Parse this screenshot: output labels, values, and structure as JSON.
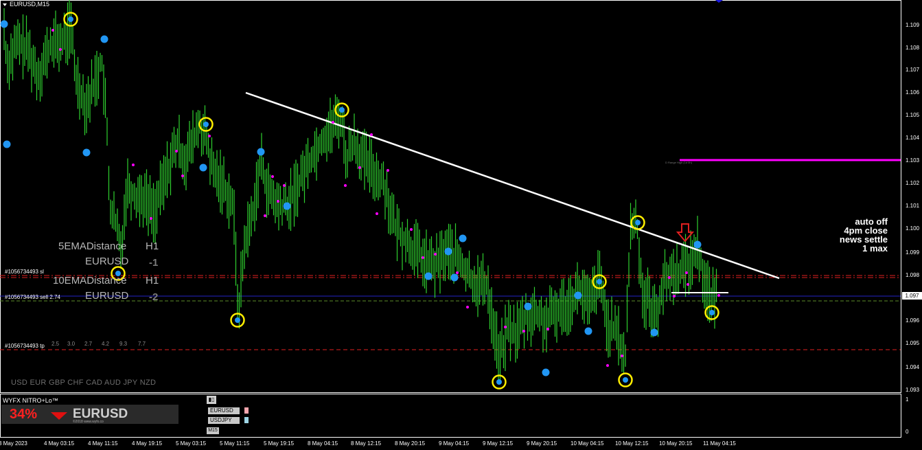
{
  "window": {
    "symbol_timeframe": "EURUSD,M15"
  },
  "price_axis": {
    "labels": [
      "1.109",
      "1.108",
      "1.107",
      "1.106",
      "1.105",
      "1.104",
      "1.103",
      "1.102",
      "1.101",
      "1.100",
      "1.099",
      "1.098",
      "1.096",
      "1.095",
      "1.094",
      "1.093"
    ],
    "current_price": "1.097",
    "current_price_value": 1.0971
  },
  "time_axis": {
    "labels": [
      "3 May 2023",
      "4 May 03:15",
      "4 May 11:15",
      "4 May 19:15",
      "5 May 03:15",
      "5 May 11:15",
      "5 May 19:15",
      "8 May 04:15",
      "8 May 12:15",
      "8 May 20:15",
      "9 May 04:15",
      "9 May 12:15",
      "9 May 20:15",
      "10 May 04:15",
      "10 May 12:15",
      "10 May 20:15",
      "11 May 04:15"
    ]
  },
  "indicators": {
    "ema5": {
      "name": "5EMADistance",
      "tf": "H1",
      "symbol": "EURUSD",
      "value": "-1"
    },
    "ema10": {
      "name": "10EMADistance",
      "tf": "H1",
      "symbol": "EURUSD",
      "value": "-2"
    }
  },
  "trades": {
    "sl_label": "#1056734493 sl",
    "sell_label": "#1056734493 sell 2.74",
    "tp_label": "#1056734493 tp",
    "tp_levels": [
      "2.5",
      "3.0",
      "2.7",
      "4.2",
      "9.3",
      "7.7"
    ]
  },
  "currency_strip": "USD EUR GBP CHF CAD AUD JPY NZD",
  "note": {
    "lines": [
      "auto off",
      "4pm close",
      "news settle",
      "1 max"
    ]
  },
  "subwindow": {
    "title": "WYFX NITRO+Lo™",
    "percent": "34%",
    "symbol": "EURUSD",
    "copyright": "©2018 www.wyfx.co",
    "pairs": [
      "EURUSD",
      "USDJPY"
    ],
    "pair_colors": [
      "#f4a6ae",
      "#9fd6e6"
    ],
    "timeframe": "M15",
    "scale": [
      "1",
      "0"
    ]
  },
  "colors": {
    "candles": "#2fd12f",
    "swing_dot": "#2196f3",
    "small_dot": "#ff00ff",
    "ring": "#ffee00",
    "trendline": "#ffffff",
    "resistance": "#ff00ff",
    "sl_line": "#e02020",
    "entry_line": "#2323c8",
    "down_arrow": "#e02020"
  },
  "chart_data": {
    "type": "line",
    "title": "EURUSD,M15",
    "ylim": [
      1.0928,
      1.11
    ],
    "x": [
      "3 May 2023",
      "4 May 03:15",
      "4 May 11:15",
      "4 May 19:15",
      "5 May 03:15",
      "5 May 11:15",
      "5 May 19:15",
      "8 May 04:15",
      "8 May 12:15",
      "8 May 20:15",
      "9 May 04:15",
      "9 May 12:15",
      "9 May 20:15",
      "10 May 04:15",
      "10 May 12:15",
      "10 May 20:15",
      "11 May 04:15"
    ],
    "series": [
      {
        "name": "",
        "values": [
          1.1092,
          1.1089,
          1.1045,
          1.1022,
          1.1038,
          1.1011,
          1.102,
          1.1045,
          1.1035,
          1.1003,
          1.0985,
          1.096,
          1.0973,
          1.0968,
          1.0975,
          1.0978,
          1.0972
        ]
      }
    ],
    "levels": {
      "resistance": 1.1031,
      "sl": 1.098,
      "entry": 1.0971,
      "tp": 1.0948
    }
  }
}
